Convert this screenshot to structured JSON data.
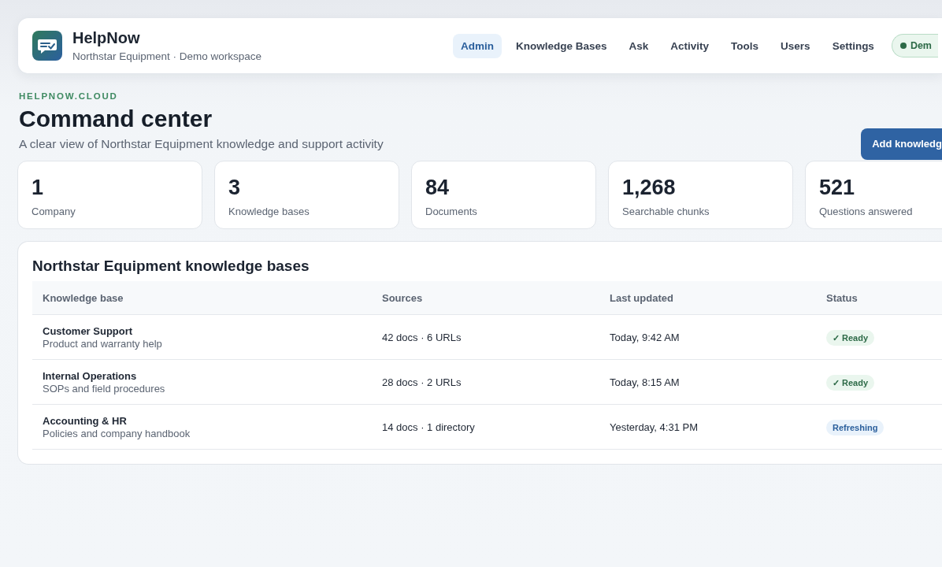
{
  "app": {
    "name": "HelpNow",
    "subtitle": "Northstar Equipment · Demo workspace"
  },
  "nav": [
    {
      "label": "Admin",
      "selected": true
    },
    {
      "label": "Knowledge Bases",
      "selected": false
    },
    {
      "label": "Ask",
      "selected": false
    },
    {
      "label": "Activity",
      "selected": false
    },
    {
      "label": "Tools",
      "selected": false
    },
    {
      "label": "Users",
      "selected": false
    },
    {
      "label": "Settings",
      "selected": false
    }
  ],
  "demo_badge": "Dem",
  "eyebrow": "HELPNOW.CLOUD",
  "title": "Command center",
  "subtitle": "A clear view of Northstar Equipment knowledge and support activity",
  "primary_button": "Add knowledg",
  "stats": [
    {
      "value": "1",
      "label": "Company"
    },
    {
      "value": "3",
      "label": "Knowledge bases"
    },
    {
      "value": "84",
      "label": "Documents"
    },
    {
      "value": "1,268",
      "label": "Searchable chunks"
    },
    {
      "value": "521",
      "label": "Questions answered"
    }
  ],
  "table": {
    "title": "Northstar Equipment knowledge bases",
    "columns": [
      "Knowledge base",
      "Sources",
      "Last updated",
      "Status"
    ],
    "rows": [
      {
        "name": "Customer Support",
        "description": "Product and warranty help",
        "sources": "42 docs · 6 URLs",
        "updated": "Today, 9:42 AM",
        "status": {
          "kind": "ready",
          "label": "✓ Ready"
        }
      },
      {
        "name": "Internal Operations",
        "description": "SOPs and field procedures",
        "sources": "28 docs · 2 URLs",
        "updated": "Today, 8:15 AM",
        "status": {
          "kind": "ready",
          "label": "✓ Ready"
        }
      },
      {
        "name": "Accounting & HR",
        "description": "Policies and company handbook",
        "sources": "14 docs · 1 directory",
        "updated": "Yesterday, 4:31 PM",
        "status": {
          "kind": "refreshing",
          "label": "Refreshing"
        }
      }
    ]
  }
}
